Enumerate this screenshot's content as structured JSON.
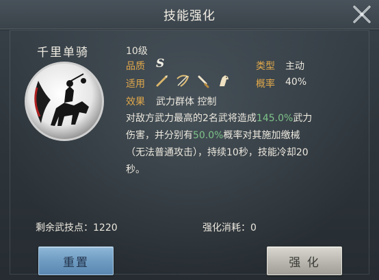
{
  "header": {
    "title": "技能强化"
  },
  "skill": {
    "name": "千里单骑",
    "level": "10级",
    "quality_label": "品质",
    "quality_value": "S",
    "type_label": "类型",
    "type_value": "主动",
    "apply_label": "适用",
    "apply_icons": [
      "spear-icon",
      "bow-icon",
      "sword-icon",
      "horse-icon"
    ],
    "rate_label": "概率",
    "rate_value": "40%",
    "effect_label": "效果",
    "effect_value": "武力群体 控制",
    "desc": {
      "p1": "对敌方武力最高的2名武将造成",
      "p2": "145.0%",
      "p3": "武力伤害，并分别有",
      "p4": "50.0%",
      "p5": "概率对其施加缴械（无法普通攻击），持续10秒，技能冷却20秒。"
    }
  },
  "footer": {
    "remaining_points": "剩余武技点：1220",
    "enhance_cost": "强化消耗：0"
  },
  "buttons": {
    "reset": "重置",
    "enhance": "强 化"
  },
  "colors": {
    "label": "#e0a84b",
    "highlight": "#7fc48a",
    "reset_button": "#6f9cc2",
    "enhance_button": "#b8b6ae"
  }
}
